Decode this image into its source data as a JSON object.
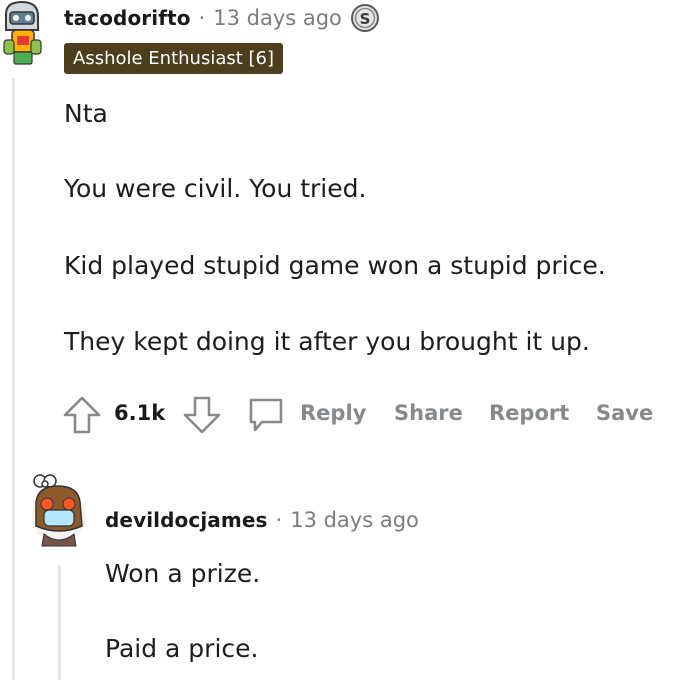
{
  "comment": {
    "username": "tacodorifto",
    "separator": "·",
    "time": "13 days ago",
    "flair": "Asshole Enthusiast [6]",
    "paragraphs": [
      "Nta",
      "You were civil. You tried.",
      "Kid played stupid game won a stupid price.",
      "They kept doing it after you brought it up."
    ],
    "votes": "6.1k",
    "actions": {
      "reply": "Reply",
      "share": "Share",
      "report": "Report",
      "save": "Save"
    }
  },
  "reply": {
    "username": "devildocjames",
    "separator": "·",
    "time": "13 days ago",
    "paragraphs": [
      "Won a prize.",
      "Paid a price."
    ]
  }
}
